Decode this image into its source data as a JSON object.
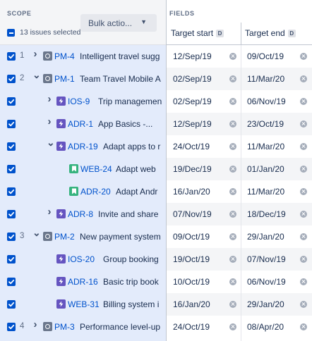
{
  "scope": {
    "title": "SCOPE",
    "bulk_actions_label": "Bulk actio...",
    "selection_text": "13 issues selected"
  },
  "fields": {
    "title": "FIELDS",
    "columns": [
      {
        "label": "Target start",
        "badge": "D"
      },
      {
        "label": "Target end",
        "badge": "D"
      }
    ]
  },
  "colors": {
    "selected_row_bg": "#e3ebfb",
    "checkbox": "#0052cc",
    "issue_key": "#0052cc",
    "initiative_icon": "#6b778c",
    "epic_icon": "#6554c0",
    "story_icon": "#36b37e",
    "alt_row_bg": "#f4f5f7"
  },
  "rows": [
    {
      "rank": "1",
      "level": 0,
      "expander": "chevron-right",
      "type": "initiative",
      "key": "PM-4",
      "summary": "Intelligent travel sugg",
      "start": "12/Sep/19",
      "end": "09/Oct/19"
    },
    {
      "rank": "2",
      "level": 0,
      "expander": "chevron-down",
      "type": "initiative",
      "key": "PM-1",
      "summary": "Team Travel Mobile A",
      "start": "02/Sep/19",
      "end": "11/Mar/20"
    },
    {
      "rank": "",
      "level": 1,
      "expander": "chevron-right",
      "type": "epic",
      "key": "IOS-9",
      "summary": "Trip management",
      "start": "02/Sep/19",
      "end": "06/Nov/19"
    },
    {
      "rank": "",
      "level": 1,
      "expander": "chevron-right",
      "type": "epic",
      "key": "ADR-1",
      "summary": "App Basics -...",
      "start": "12/Sep/19",
      "end": "23/Oct/19"
    },
    {
      "rank": "",
      "level": 1,
      "expander": "chevron-down",
      "type": "epic",
      "key": "ADR-19",
      "summary": "Adapt apps to r",
      "start": "24/Oct/19",
      "end": "11/Mar/20"
    },
    {
      "rank": "",
      "level": 2,
      "expander": "",
      "type": "story",
      "key": "WEB-24",
      "summary": "Adapt web",
      "start": "19/Dec/19",
      "end": "01/Jan/20"
    },
    {
      "rank": "",
      "level": 2,
      "expander": "",
      "type": "story",
      "key": "ADR-20",
      "summary": "Adapt Andr",
      "start": "16/Jan/20",
      "end": "11/Mar/20"
    },
    {
      "rank": "",
      "level": 1,
      "expander": "chevron-right",
      "type": "epic",
      "key": "ADR-8",
      "summary": "Invite and share",
      "start": "07/Nov/19",
      "end": "18/Dec/19"
    },
    {
      "rank": "3",
      "level": 0,
      "expander": "chevron-down",
      "type": "initiative",
      "key": "PM-2",
      "summary": "New payment system",
      "start": "09/Oct/19",
      "end": "29/Jan/20"
    },
    {
      "rank": "",
      "level": 1,
      "expander": "",
      "type": "epic",
      "key": "IOS-20",
      "summary": "Group booking",
      "start": "19/Oct/19",
      "end": "07/Nov/19"
    },
    {
      "rank": "",
      "level": 1,
      "expander": "",
      "type": "epic",
      "key": "ADR-16",
      "summary": "Basic trip book",
      "start": "10/Oct/19",
      "end": "06/Nov/19"
    },
    {
      "rank": "",
      "level": 1,
      "expander": "",
      "type": "epic",
      "key": "WEB-31",
      "summary": "Billing system i",
      "start": "16/Jan/20",
      "end": "29/Jan/20"
    },
    {
      "rank": "4",
      "level": 0,
      "expander": "chevron-right",
      "type": "initiative",
      "key": "PM-3",
      "summary": "Performance level-up",
      "start": "24/Oct/19",
      "end": "08/Apr/20"
    }
  ]
}
